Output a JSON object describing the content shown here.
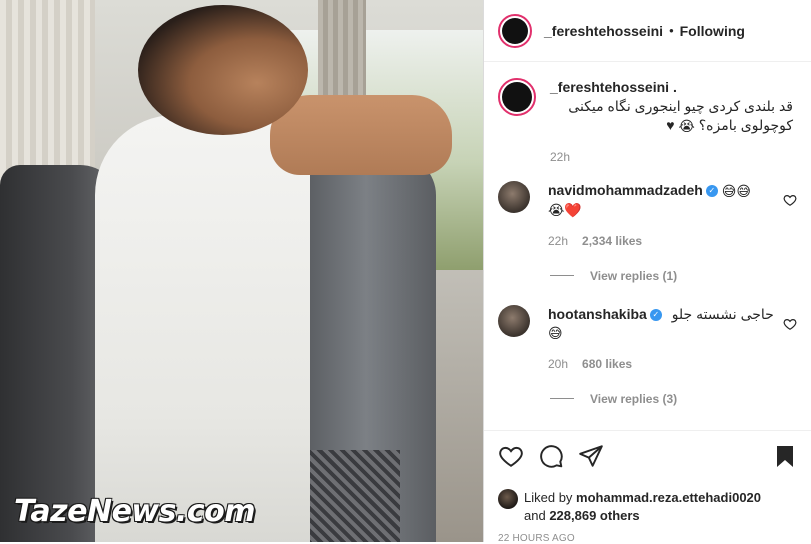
{
  "photo": {
    "watermark": "TazeNews.com",
    "alt": "Photo post"
  },
  "header": {
    "username": "_fereshtehosseini",
    "separator": "•",
    "follow_status": "Following"
  },
  "caption": {
    "username": "_fereshtehosseini .",
    "text_line1": "قد بلندی کردی چیو اینجوری نگاه میکنی",
    "text_line2": "کوچولوی بامزه؟",
    "emoji": "😭",
    "heart": "♥",
    "time": "22h"
  },
  "comments": [
    {
      "username": "navidmohammadzadeh",
      "emojis_line1": "😅😅",
      "emojis_line2": "😭❤️",
      "time": "22h",
      "likes": "2,334 likes",
      "view_replies": "View replies (1)"
    },
    {
      "username": "hootanshakiba",
      "text": "حاجی نشسته جلو",
      "emojis_line2": "😅",
      "time": "20h",
      "likes": "680 likes",
      "view_replies": "View replies (3)"
    }
  ],
  "actions": {
    "liked_by_prefix": "Liked by",
    "liked_by_user": "mohammad.reza.ettehadi0020",
    "and_word": "and",
    "others_count": "228,869 others",
    "timestamp": "22 HOURS AGO"
  },
  "colors": {
    "story_ring": "#e1306c",
    "verified": "#3897f0",
    "muted": "#8e8e8e"
  }
}
